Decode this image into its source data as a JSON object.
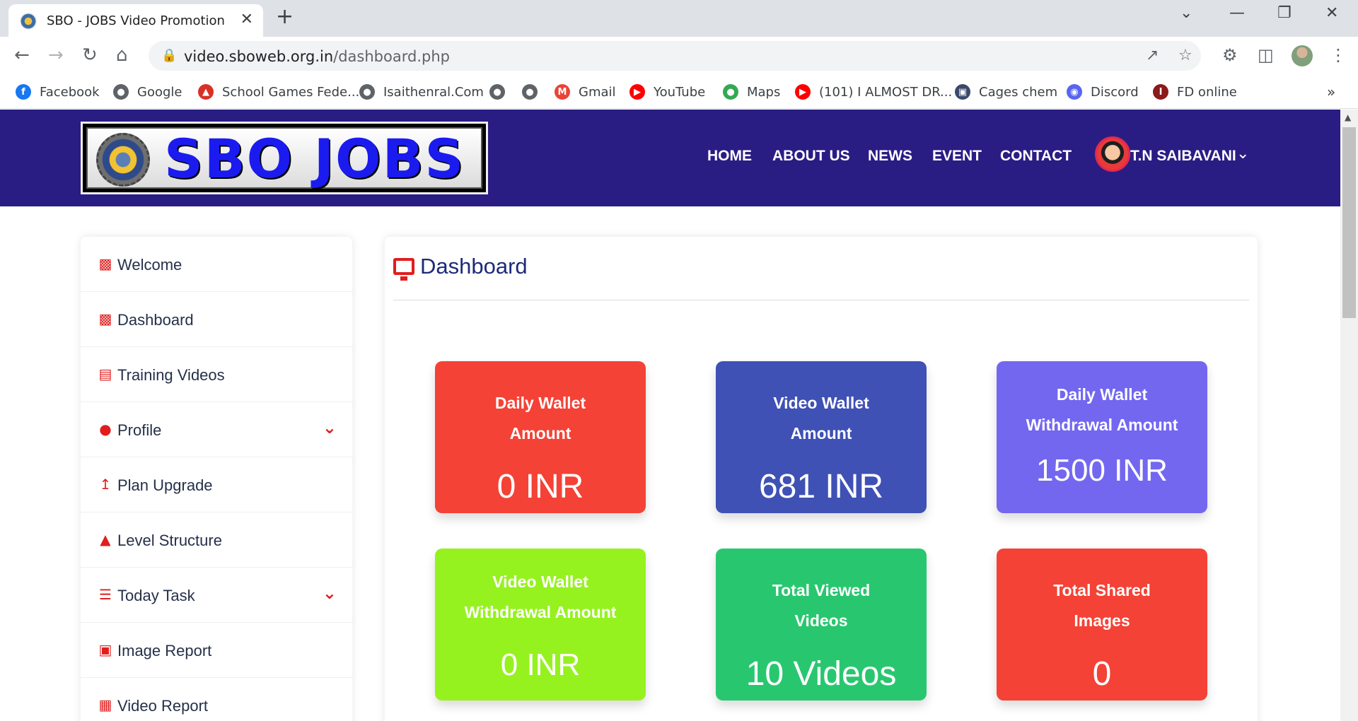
{
  "browser": {
    "tab_title": "SBO - JOBS Video Promotion",
    "close_glyph": "✕",
    "new_tab_glyph": "+",
    "url_domain": "video.sboweb.org.in",
    "url_path": "/dashboard.php",
    "bookmarks": [
      {
        "label": "Facebook",
        "icon": "facebook-icon",
        "color": "#1877f2"
      },
      {
        "label": "Google",
        "icon": "globe-icon",
        "color": "#5f6368"
      },
      {
        "label": "School Games Fede...",
        "icon": "flame-icon",
        "color": "#d93025"
      },
      {
        "label": "Isaithenral.Com",
        "icon": "globe-icon",
        "color": "#5f6368"
      },
      {
        "label": "",
        "icon": "globe-icon",
        "color": "#5f6368"
      },
      {
        "label": "",
        "icon": "globe-icon",
        "color": "#5f6368"
      },
      {
        "label": "Gmail",
        "icon": "gmail-icon",
        "color": "#ea4335"
      },
      {
        "label": "YouTube",
        "icon": "youtube-icon",
        "color": "#ff0000"
      },
      {
        "label": "Maps",
        "icon": "maps-icon",
        "color": "#34a853"
      },
      {
        "label": "(101) I ALMOST DR...",
        "icon": "youtube-icon",
        "color": "#ff0000"
      },
      {
        "label": "Cages chem",
        "icon": "crest-icon",
        "color": "#3b4a6b"
      },
      {
        "label": "Discord",
        "icon": "discord-icon",
        "color": "#5865f2"
      },
      {
        "label": "FD online",
        "icon": "bookmark-icon",
        "color": "#8b1a1a"
      }
    ],
    "overflow_glyph": "»"
  },
  "site": {
    "brand": "SBO JOBS",
    "nav": [
      "HOME",
      "ABOUT US",
      "NEWS",
      "EVENT",
      "CONTACT"
    ],
    "user_name": "T.N SAIBAVANI"
  },
  "sidebar": {
    "items": [
      {
        "label": "Welcome",
        "icon": "desktop-icon",
        "has_submenu": false
      },
      {
        "label": "Dashboard",
        "icon": "desktop-icon",
        "has_submenu": false
      },
      {
        "label": "Training Videos",
        "icon": "id-card-icon",
        "has_submenu": false
      },
      {
        "label": "Profile",
        "icon": "user-icon",
        "has_submenu": true
      },
      {
        "label": "Plan Upgrade",
        "icon": "arrow-up-icon",
        "has_submenu": false
      },
      {
        "label": "Level Structure",
        "icon": "sitemap-icon",
        "has_submenu": false
      },
      {
        "label": "Today Task",
        "icon": "list-icon",
        "has_submenu": true
      },
      {
        "label": "Image Report",
        "icon": "image-icon",
        "has_submenu": false
      },
      {
        "label": "Video Report",
        "icon": "film-icon",
        "has_submenu": false
      }
    ]
  },
  "dashboard": {
    "title": "Dashboard",
    "cards": [
      {
        "title_lines": [
          "Daily Wallet",
          "Amount"
        ],
        "value": "0 INR",
        "color": "#f44236"
      },
      {
        "title_lines": [
          "Video Wallet",
          "Amount"
        ],
        "value": "681 INR",
        "color": "#3f51b5"
      },
      {
        "title_lines": [
          "Daily Wallet",
          "Withdrawal Amount"
        ],
        "value": "1500 INR",
        "color": "#7367f0"
      },
      {
        "title_lines": [
          "Video Wallet",
          "Withdrawal Amount"
        ],
        "value": "0 INR",
        "color": "#96f21f"
      },
      {
        "title_lines": [
          "Total Viewed",
          "Videos"
        ],
        "value": "10 Videos",
        "color": "#28c76f"
      },
      {
        "title_lines": [
          "Total Shared",
          "Images"
        ],
        "value": "0",
        "color": "#f44236"
      }
    ]
  }
}
